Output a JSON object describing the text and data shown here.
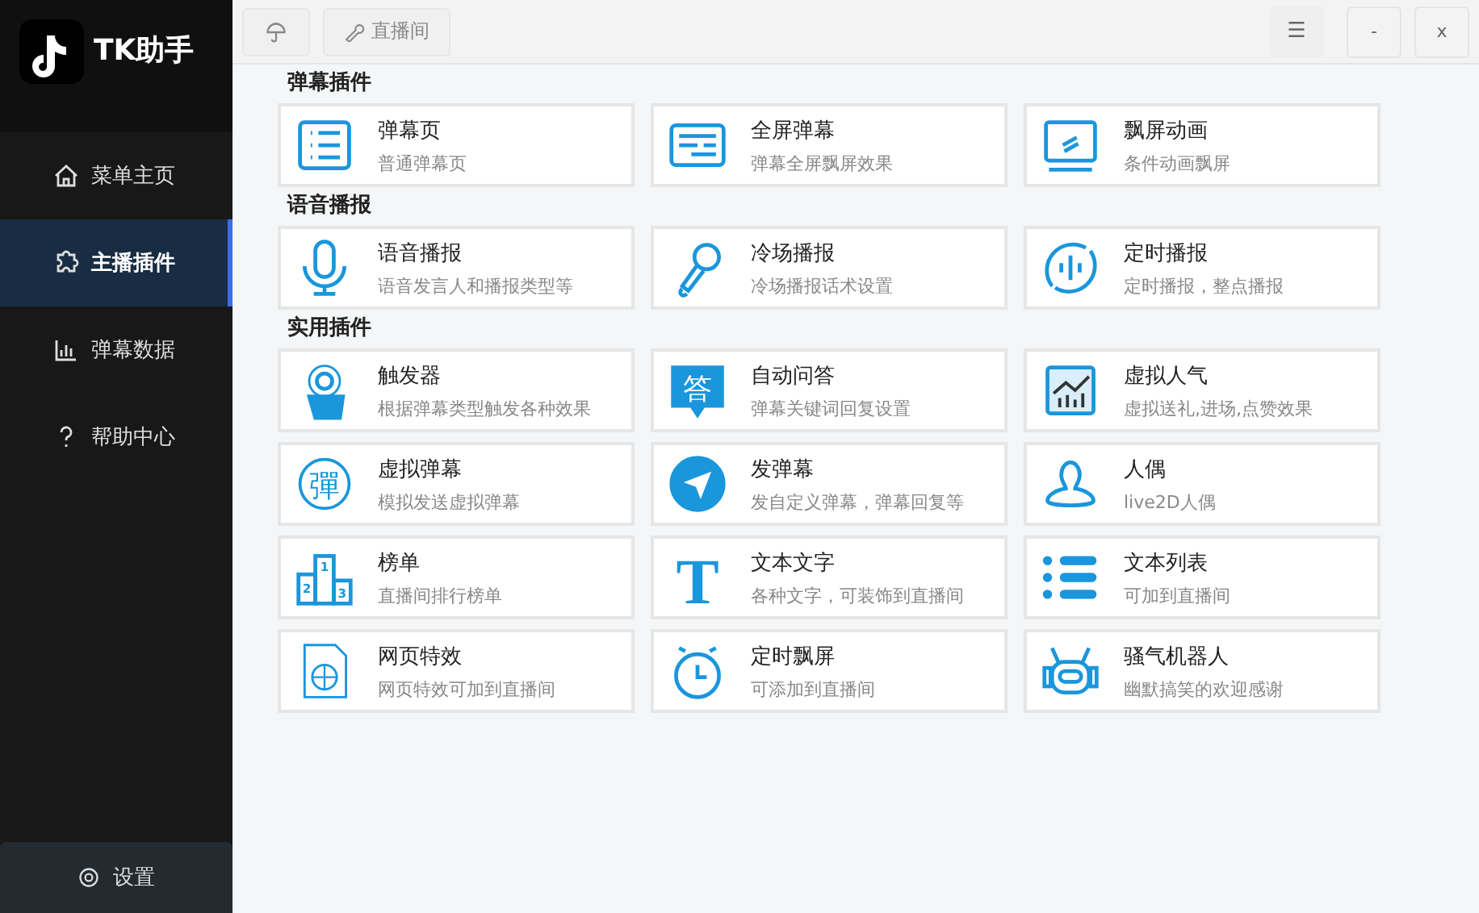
{
  "app": {
    "title": "TK助手"
  },
  "sidebar": {
    "items": [
      {
        "label": "菜单主页",
        "kind": "home",
        "selected": false
      },
      {
        "label": "主播插件",
        "kind": "puzzle",
        "selected": true
      },
      {
        "label": "弹幕数据",
        "kind": "chart",
        "selected": false
      },
      {
        "label": "帮助中心",
        "kind": "help",
        "selected": false
      }
    ],
    "settings": {
      "label": "设置"
    }
  },
  "toolbar": {
    "room_button": "直播间",
    "menu": "☰",
    "minimize": "-",
    "close": "x"
  },
  "sections": [
    {
      "title": "弹幕插件",
      "cards": [
        {
          "title": "弹幕页",
          "desc": "普通弹幕页",
          "kind": "list"
        },
        {
          "title": "全屏弹幕",
          "desc": "弹幕全屏飘屏效果",
          "kind": "panel"
        },
        {
          "title": "飘屏动画",
          "desc": "条件动画飘屏",
          "kind": "monitor"
        }
      ]
    },
    {
      "title": "语音播报",
      "cards": [
        {
          "title": "语音播报",
          "desc": "语音发言人和播报类型等",
          "kind": "mic"
        },
        {
          "title": "冷场播报",
          "desc": "冷场播报话术设置",
          "kind": "handmic"
        },
        {
          "title": "定时播报",
          "desc": "定时播报，整点播报",
          "kind": "cycle"
        }
      ]
    },
    {
      "title": "实用插件",
      "cards": [
        {
          "title": "触发器",
          "desc": "根据弹幕类型触发各种效果",
          "kind": "touch"
        },
        {
          "title": "自动问答",
          "desc": "弹幕关键词回复设置",
          "kind": "bubble",
          "icon_text": "答"
        },
        {
          "title": "虚拟人气",
          "desc": "虚拟送礼,进场,点赞效果",
          "kind": "trend"
        },
        {
          "title": "虚拟弹幕",
          "desc": "模拟发送虚拟弹幕",
          "kind": "circletext",
          "icon_text": "彈"
        },
        {
          "title": "发弹幕",
          "desc": "发自定义弹幕，弹幕回复等",
          "kind": "send"
        },
        {
          "title": "人偶",
          "desc": "live2D人偶",
          "kind": "person"
        },
        {
          "title": "榜单",
          "desc": "直播间排行榜单",
          "kind": "podium",
          "icon_labels": [
            "2",
            "1",
            "3"
          ]
        },
        {
          "title": "文本文字",
          "desc": "各种文字，可装饰到直播间",
          "kind": "letter",
          "icon_text": "T"
        },
        {
          "title": "文本列表",
          "desc": "可加到直播间",
          "kind": "bullets"
        },
        {
          "title": "网页特效",
          "desc": "网页特效可加到直播间",
          "kind": "globe"
        },
        {
          "title": "定时飘屏",
          "desc": "可添加到直播间",
          "kind": "clock"
        },
        {
          "title": "骚气机器人",
          "desc": "幽默搞笑的欢迎感谢",
          "kind": "robot"
        }
      ]
    }
  ]
}
